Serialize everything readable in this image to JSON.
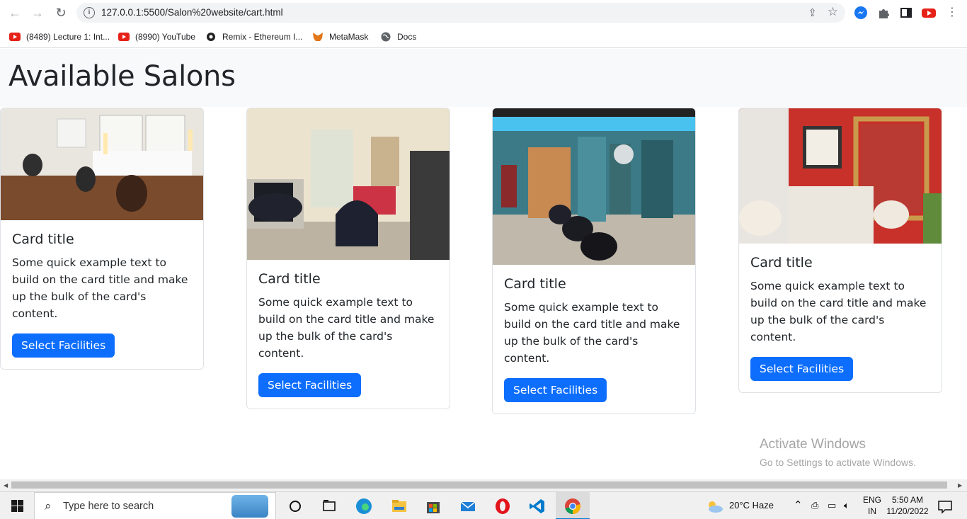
{
  "browser": {
    "url": "127.0.0.1:5500/Salon%20website/cart.html",
    "bookmarks": [
      {
        "label": "(8489) Lecture 1: Int...",
        "icon": "youtube-icon"
      },
      {
        "label": "(8990) YouTube",
        "icon": "youtube-icon"
      },
      {
        "label": "Remix - Ethereum I...",
        "icon": "remix-icon"
      },
      {
        "label": "MetaMask",
        "icon": "metamask-fox-icon"
      },
      {
        "label": "Docs",
        "icon": "globe-icon"
      }
    ]
  },
  "page": {
    "title": "Available Salons",
    "cards": [
      {
        "title": "Card title",
        "text": "Some quick example text to build on the card title and make up the bulk of the card's content.",
        "button": "Select Facilities"
      },
      {
        "title": "Card title",
        "text": "Some quick example text to build on the card title and make up the bulk of the card's content.",
        "button": "Select Facilities"
      },
      {
        "title": "Card title",
        "text": "Some quick example text to build on the card title and make up the bulk of the card's content.",
        "button": "Select Facilities"
      },
      {
        "title": "Card title",
        "text": "Some quick example text to build on the card title and make up the bulk of the card's content.",
        "button": "Select Facilities"
      }
    ]
  },
  "watermark": {
    "line1": "Activate Windows",
    "line2": "Go to Settings to activate Windows."
  },
  "taskbar": {
    "search_placeholder": "Type here to search",
    "weather": "20°C  Haze",
    "language": "ENG",
    "region": "IN",
    "time": "5:50 AM",
    "date": "11/20/2022"
  },
  "colors": {
    "primary_button": "#0d6efd",
    "header_band": "#f8f9fa"
  }
}
